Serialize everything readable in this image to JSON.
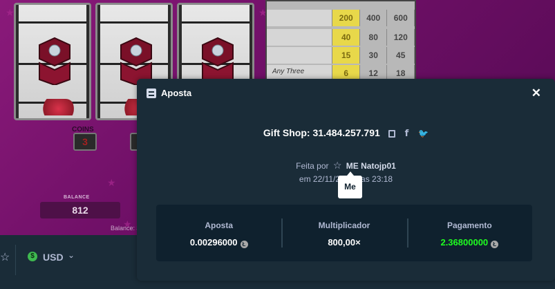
{
  "game_bg": {
    "reel_count": 3,
    "paytable": [
      {
        "symbol": "gift-icon",
        "text": "",
        "values": [
          "200",
          "400",
          "600"
        ]
      },
      {
        "symbol": "teddy-icon",
        "text": "",
        "values": [
          "40",
          "80",
          "120"
        ]
      },
      {
        "symbol": "rose-icon",
        "text": "",
        "values": [
          "15",
          "30",
          "45"
        ]
      },
      {
        "symbol": "any-three",
        "text": "Any Three",
        "values": [
          "6",
          "12",
          "18"
        ]
      }
    ],
    "coins_label": "COINS",
    "coins_value": "3",
    "balance_label": "BALANCE",
    "balance_value": "812",
    "balance_small": "Balance: $"
  },
  "footer": {
    "currency": "USD"
  },
  "modal": {
    "title": "Aposta",
    "game_name": "Gift Shop:",
    "bet_id": "31.484.257.791",
    "placed_by": "Feita por",
    "user_prefix": "ME",
    "username": "Natojp01",
    "date_prefix": "em 22/11/2",
    "date_suffix": "as 23:18",
    "tooltip": "Me",
    "stats": [
      {
        "label": "Aposta",
        "value": "0.00296000",
        "coin": true,
        "green": false
      },
      {
        "label": "Multiplicador",
        "value": "800,00×",
        "coin": false,
        "green": false
      },
      {
        "label": "Pagamento",
        "value": "2.36800000",
        "coin": true,
        "green": true
      }
    ]
  },
  "colors": {
    "accent_green": "#1fff20",
    "modal_bg": "#1a2c38",
    "stats_bg": "#0f212e"
  }
}
